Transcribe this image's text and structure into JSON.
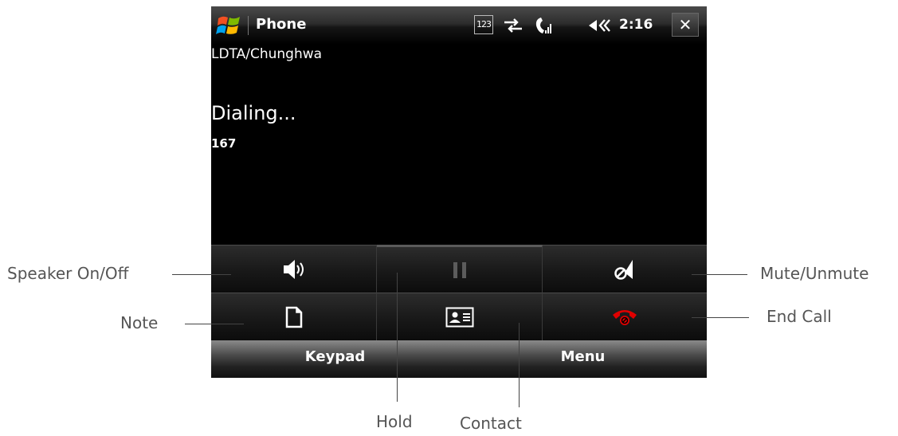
{
  "window": {
    "title": "Phone",
    "ime_mode": "123",
    "clock": "2:16",
    "close_label": "✕"
  },
  "call": {
    "operator": "LDTA/Chunghwa",
    "status": "Dialing...",
    "number": "167"
  },
  "controls": [
    {
      "name": "speaker",
      "icon": "speaker-icon"
    },
    {
      "name": "hold",
      "icon": "pause-icon",
      "state": "disabled"
    },
    {
      "name": "mute",
      "icon": "mute-icon"
    },
    {
      "name": "note",
      "icon": "note-icon"
    },
    {
      "name": "contact",
      "icon": "contact-card-icon"
    },
    {
      "name": "end-call",
      "icon": "end-call-icon",
      "color": "#e00000"
    }
  ],
  "softkeys": {
    "left": "Keypad",
    "right": "Menu"
  },
  "annotations": {
    "speaker": "Speaker On/Off",
    "note": "Note",
    "mute": "Mute/Unmute",
    "end_call": "End Call",
    "hold": "Hold",
    "contact": "Contact"
  },
  "colors": {
    "background": "#000000",
    "end_call_red": "#e00000",
    "label_gray": "#555555"
  }
}
